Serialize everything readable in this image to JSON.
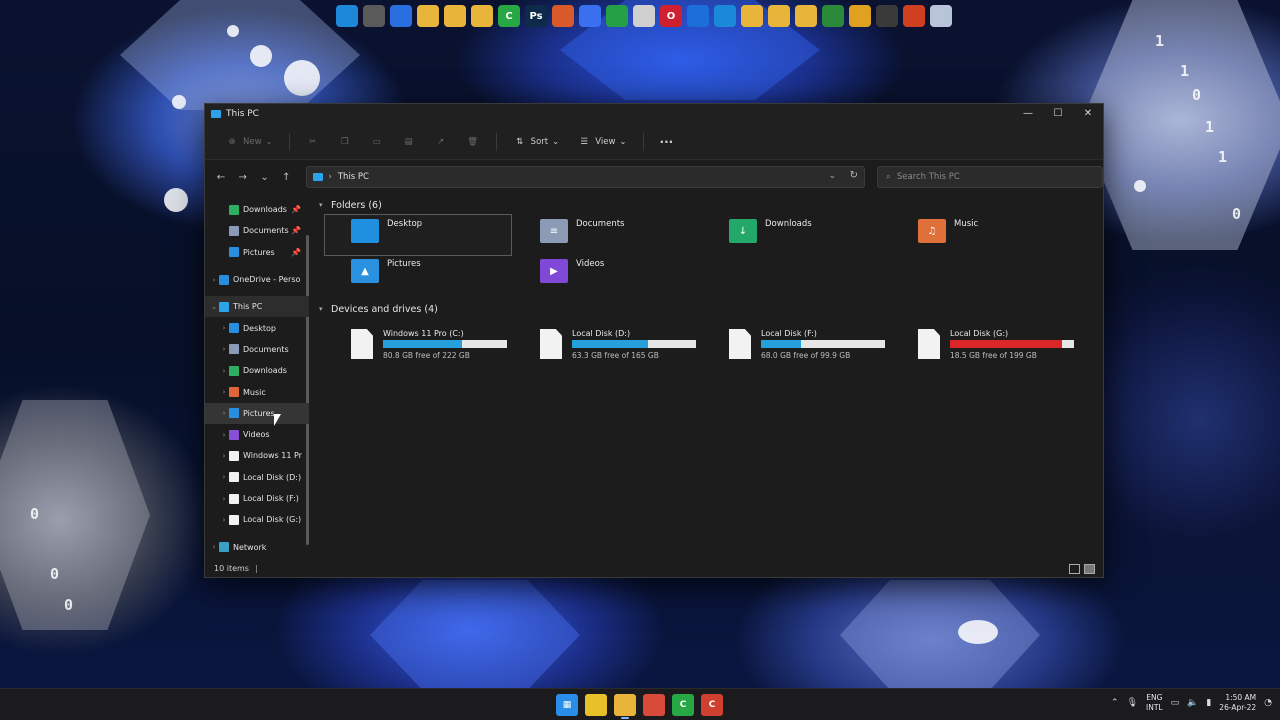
{
  "window": {
    "title": "This PC"
  },
  "toolbar": {
    "new_label": "New",
    "sort_label": "Sort",
    "view_label": "View",
    "more_label": "···"
  },
  "address": {
    "crumb": "This PC",
    "separator": "›"
  },
  "search": {
    "placeholder": "Search This PC"
  },
  "sidebar": {
    "quick_access": [
      {
        "label": "Downloads",
        "color": "#2fae63"
      },
      {
        "label": "Documents",
        "color": "#8a9ab8"
      },
      {
        "label": "Pictures",
        "color": "#2a8ee0"
      }
    ],
    "onedrive": "OneDrive - Perso",
    "this_pc": "This PC",
    "this_pc_items": [
      {
        "label": "Desktop",
        "color": "#2a8ee0"
      },
      {
        "label": "Documents",
        "color": "#8a9ab8"
      },
      {
        "label": "Downloads",
        "color": "#2fae63"
      },
      {
        "label": "Music",
        "color": "#e0653a"
      },
      {
        "label": "Pictures",
        "color": "#2a8ee0"
      },
      {
        "label": "Videos",
        "color": "#8a4fd8"
      },
      {
        "label": "Windows 11 Pr",
        "color": "#f2f2f2"
      },
      {
        "label": "Local Disk (D:)",
        "color": "#f2f2f2"
      },
      {
        "label": "Local Disk (F:)",
        "color": "#f2f2f2"
      },
      {
        "label": "Local Disk (G:)",
        "color": "#f2f2f2"
      }
    ],
    "network": "Network"
  },
  "folders_section": {
    "title": "Folders (6)",
    "items": [
      {
        "label": "Desktop",
        "color": "#1f8fe0",
        "glyph": ""
      },
      {
        "label": "Documents",
        "color": "#8b9ab5",
        "glyph": "≡"
      },
      {
        "label": "Downloads",
        "color": "#23a86a",
        "glyph": "↓"
      },
      {
        "label": "Music",
        "color": "#e0703a",
        "glyph": "♫"
      },
      {
        "label": "Pictures",
        "color": "#2a90e0",
        "glyph": "▲"
      },
      {
        "label": "Videos",
        "color": "#8048d6",
        "glyph": "▶"
      }
    ]
  },
  "drives_section": {
    "title": "Devices and drives (4)",
    "items": [
      {
        "name": "Windows 11 Pro (C:)",
        "free": "80.8 GB free of 222 GB",
        "used_fraction": 0.636,
        "bar_color": "#26a0da"
      },
      {
        "name": "Local Disk (D:)",
        "free": "63.3 GB free of 165 GB",
        "used_fraction": 0.616,
        "bar_color": "#26a0da"
      },
      {
        "name": "Local Disk (F:)",
        "free": "68.0 GB free of 99.9 GB",
        "used_fraction": 0.319,
        "bar_color": "#26a0da"
      },
      {
        "name": "Local Disk (G:)",
        "free": "18.5 GB free of 199 GB",
        "used_fraction": 0.907,
        "bar_color": "#da2626"
      }
    ]
  },
  "status": {
    "items": "10 items",
    "caret": "|"
  },
  "tray": {
    "lang_top": "ENG",
    "lang_bottom": "INTL",
    "time": "1:50 AM",
    "date": "26-Apr-22"
  },
  "top_dock": [
    {
      "name": "this-pc-icon",
      "color": "#1e88d8",
      "glyph": ""
    },
    {
      "name": "archive-icon",
      "color": "#5a5a5a",
      "glyph": ""
    },
    {
      "name": "firefox-icon",
      "color": "#2a6fe0",
      "glyph": ""
    },
    {
      "name": "folder-icon",
      "color": "#e8b53a",
      "glyph": ""
    },
    {
      "name": "folder-icon",
      "color": "#e8b53a",
      "glyph": ""
    },
    {
      "name": "folder-icon",
      "color": "#e8b53a",
      "glyph": ""
    },
    {
      "name": "camtasia-icon",
      "color": "#27a845",
      "glyph": "C"
    },
    {
      "name": "photoshop-icon",
      "color": "#0d2a4a",
      "glyph": "Ps"
    },
    {
      "name": "search-tool-icon",
      "color": "#d85a2a",
      "glyph": ""
    },
    {
      "name": "messenger-icon",
      "color": "#3a6ff0",
      "glyph": ""
    },
    {
      "name": "whatsapp-icon",
      "color": "#25a046",
      "glyph": ""
    },
    {
      "name": "calendar-icon",
      "color": "#d0d0d0",
      "glyph": ""
    },
    {
      "name": "opera-icon",
      "color": "#d02030",
      "glyph": "O"
    },
    {
      "name": "teamviewer-icon",
      "color": "#1c6fd8",
      "glyph": ""
    },
    {
      "name": "vscode-icon",
      "color": "#1a8ad8",
      "glyph": ""
    },
    {
      "name": "folder-icon",
      "color": "#e8b53a",
      "glyph": ""
    },
    {
      "name": "folder-icon",
      "color": "#e8b53a",
      "glyph": ""
    },
    {
      "name": "folder-icon",
      "color": "#e8b53a",
      "glyph": ""
    },
    {
      "name": "globe-icon",
      "color": "#2a8a3a",
      "glyph": ""
    },
    {
      "name": "chrome-icon",
      "color": "#e0a020",
      "glyph": ""
    },
    {
      "name": "terminal-icon",
      "color": "#3a3a3a",
      "glyph": ""
    },
    {
      "name": "tools-icon",
      "color": "#d04020",
      "glyph": ""
    },
    {
      "name": "recycle-bin-icon",
      "color": "#b8c4d8",
      "glyph": ""
    }
  ],
  "taskbar_apps": [
    {
      "name": "start-icon",
      "color": "#2a8ee8",
      "glyph": "▦"
    },
    {
      "name": "sticky-notes-icon",
      "color": "#e8c02a",
      "glyph": ""
    },
    {
      "name": "file-explorer-icon",
      "color": "#e8b53a",
      "glyph": ""
    },
    {
      "name": "chrome-icon",
      "color": "#d84a3a",
      "glyph": ""
    },
    {
      "name": "camtasia-icon",
      "color": "#27a845",
      "glyph": "C"
    },
    {
      "name": "recorder-icon",
      "color": "#d04030",
      "glyph": "C"
    }
  ]
}
